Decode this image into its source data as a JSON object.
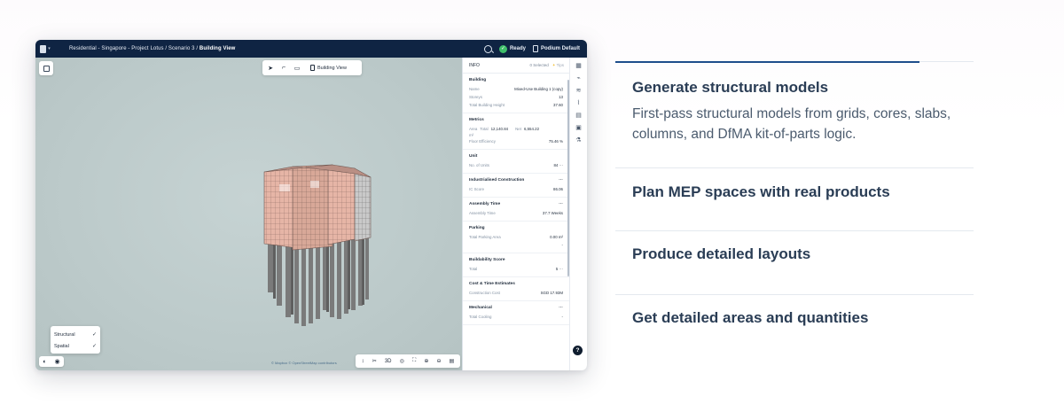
{
  "app": {
    "breadcrumb_prefix": "Residential - Singapore - Project Lotus / Scenario 3 / ",
    "breadcrumb_current": "Building View",
    "status": "Ready",
    "podium": "Podium Default",
    "view_label": "Building View",
    "attribution": "© Mapbox  © OpenStreetMap contributors",
    "layers": [
      {
        "label": "Structural",
        "checked": true
      },
      {
        "label": "Spatial",
        "checked": true
      }
    ],
    "bottom_tool_zoom": "3D",
    "help_label": "?"
  },
  "panel": {
    "title": "INFO",
    "selected": "0 Selected",
    "tips": "Tips",
    "building": {
      "title": "Building",
      "name_label": "Name",
      "name_value": "Mixed-Use Building 1 (copy)",
      "storeys_label": "Storeys",
      "storeys_value": "13",
      "height_label": "Total Building Height",
      "height_value": "37.60"
    },
    "metrics": {
      "title": "Metrics",
      "area_label": "Area",
      "area_total_label": "Total",
      "area_total_value": "12,140.84",
      "area_net_label": "Net",
      "area_net_value": "6,554.22",
      "area_unit": "m²",
      "floor_eff_label": "Floor Efficiency",
      "floor_eff_value": "75.46 %"
    },
    "unit": {
      "title": "Unit",
      "units_label": "No. of Units",
      "units_value": "84"
    },
    "industrialised": {
      "title": "Industrialised Construction",
      "ic_label": "IC Score",
      "ic_value": "86.06"
    },
    "assembly": {
      "title": "Assembly Time",
      "time_label": "Assembly Time",
      "time_value": "37.7 Weeks"
    },
    "parking": {
      "title": "Parking",
      "area_label": "Total Parking Area",
      "area_value": "0.00 m²",
      "extra": "-"
    },
    "buildability": {
      "title": "Buildability Score",
      "total_label": "Total",
      "total_value": "5"
    },
    "cost": {
      "title": "Cost & Time Estimates",
      "cost_label": "Construction Cost",
      "cost_value": "SGD 17.93M"
    },
    "mechanical": {
      "title": "Mechanical",
      "cooling_label": "Total Cooling",
      "cooling_value": "-"
    },
    "more": "···"
  },
  "features": [
    {
      "title": "Generate structural models",
      "body": "First-pass structural models from grids, cores, slabs, columns, and DfMA kit-of-parts logic."
    },
    {
      "title": "Plan MEP spaces with real products"
    },
    {
      "title": "Produce detailed layouts"
    },
    {
      "title": "Get detailed areas and quantities"
    }
  ],
  "colors": {
    "accent": "#1e4e8c",
    "topbar": "#0f2443",
    "facade": "#e8b8aa",
    "status_ok": "#3fbf6a"
  },
  "active_feature_progress": 0.85
}
